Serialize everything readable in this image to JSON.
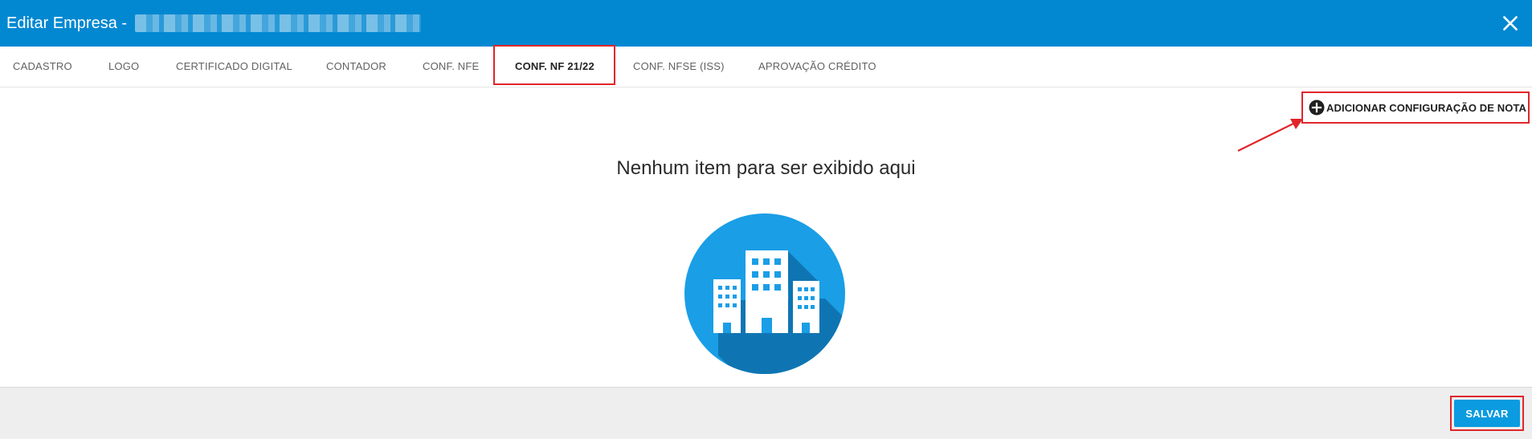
{
  "header": {
    "title": "Editar Empresa - ",
    "background": "#0288d1",
    "close_icon": "close-icon"
  },
  "tabs": [
    {
      "label": "CADASTRO",
      "active": false
    },
    {
      "label": "LOGO",
      "active": false
    },
    {
      "label": "CERTIFICADO DIGITAL",
      "active": false
    },
    {
      "label": "CONTADOR",
      "active": false
    },
    {
      "label": "CONF. NFE",
      "active": false
    },
    {
      "label": "CONF. NF 21/22",
      "active": true
    },
    {
      "label": "CONF. NFSE (ISS)",
      "active": false
    },
    {
      "label": "APROVAÇÃO CRÉDITO",
      "active": false
    }
  ],
  "toolbar": {
    "add_config_label": "ADICIONAR CONFIGURAÇÃO DE NOTA",
    "add_icon": "plus-circle-icon"
  },
  "empty_state": {
    "message": "Nenhum item para ser exibido aqui",
    "illustration": "buildings-icon"
  },
  "footer": {
    "save_label": "SALVAR"
  },
  "colors": {
    "accent": "#0288d1",
    "save_button": "#0b9be0",
    "highlight": "#e0262b",
    "illustration_circle": "#1a9ee6"
  }
}
